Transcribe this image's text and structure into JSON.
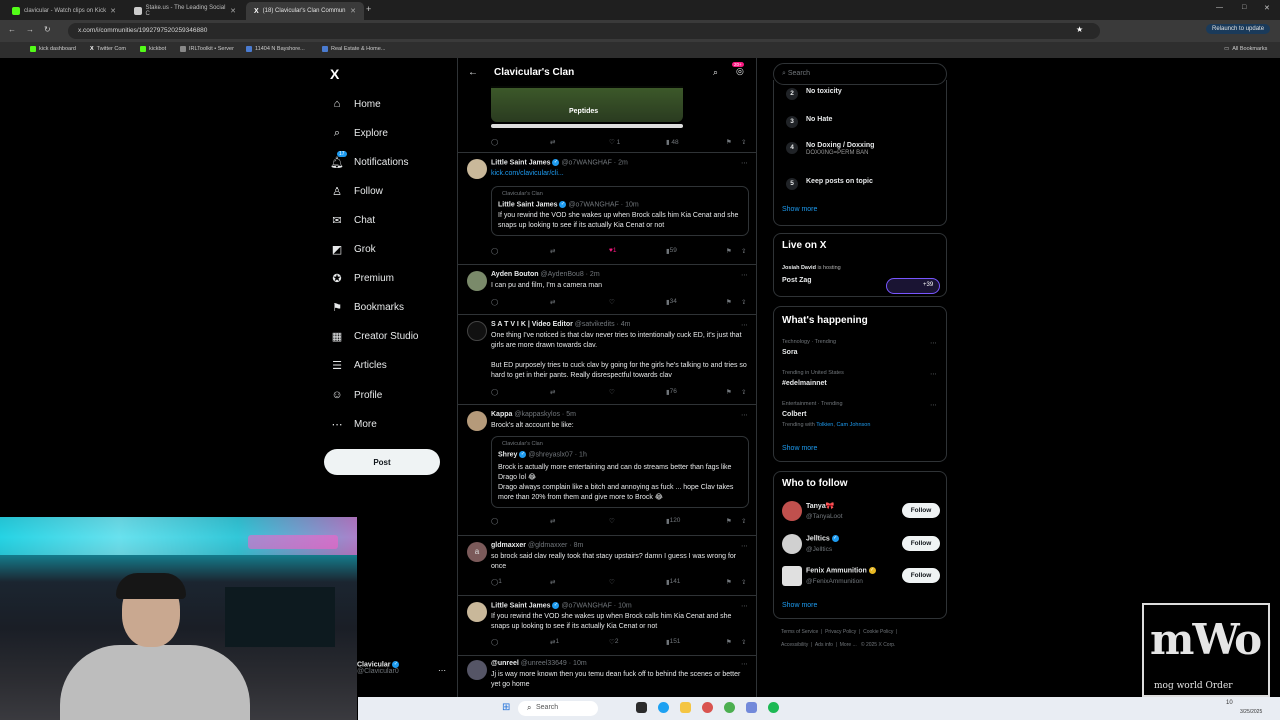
{
  "browser": {
    "tabs": [
      {
        "title": "clavicular - Watch clips on Kick",
        "color": "#53fc18"
      },
      {
        "title": "Stake.us - The Leading Social C",
        "color": "#cccccc"
      },
      {
        "title": "(18) Clavicular's Clan Commun",
        "color": "#ffffff"
      }
    ],
    "url": "x.com/i/communities/1992797520259346880",
    "relaunch": "Relaunch to update",
    "bookmarks": [
      "kick dashboard",
      "Twitter Com",
      "kickbot",
      "IRLToolkit • Server",
      "11404 N Bayshore...",
      "Real Estate & Home..."
    ],
    "all_bookmarks": "All Bookmarks"
  },
  "nav": {
    "logo": "X",
    "items": [
      {
        "label": "Home",
        "icon": "⌂"
      },
      {
        "label": "Explore",
        "icon": "⌕"
      },
      {
        "label": "Notifications",
        "icon": "🔔︎",
        "badge": "17"
      },
      {
        "label": "Follow",
        "icon": "♙"
      },
      {
        "label": "Chat",
        "icon": "✉"
      },
      {
        "label": "Grok",
        "icon": "◩"
      },
      {
        "label": "Premium",
        "icon": "✪"
      },
      {
        "label": "Bookmarks",
        "icon": "⚑"
      },
      {
        "label": "Creator Studio",
        "icon": "▦"
      },
      {
        "label": "Articles",
        "icon": "☰"
      },
      {
        "label": "Profile",
        "icon": "☺"
      },
      {
        "label": "More",
        "icon": "⋯"
      }
    ],
    "post": "Post"
  },
  "header": {
    "title": "Clavicular's Clan",
    "badge": "20+"
  },
  "top_media_label": "Peptides",
  "tweets": [
    {
      "name": "Little Saint James",
      "handle": "@o7WANGHAF · 2m",
      "text": "kick.com/clavicular/cli...",
      "quote": {
        "src": "Clavicular's Clan",
        "name": "Little Saint James",
        "handle": "@o7WANGHAF · 10m",
        "text": "If you rewind the VOD she wakes up when Brock calls him Kia Cenat and she snaps up looking to see if its actually Kia Cenat or not"
      },
      "likes": "1",
      "views": "59"
    },
    {
      "name": "Ayden Bouton",
      "handle": "@AydenBou8 · 2m",
      "text": "I can pu and film, I'm a camera man",
      "views": "34"
    },
    {
      "name": "S A T V I K | Video Editor",
      "handle": "@satvikedits · 4m",
      "text": "One thing I've noticed is that clav never tries to intentionally cuck ED, it's just that girls are more drawn towards clav.",
      "text2": "But ED purposely tries to cuck clav by going for the girls he's talking to and tries so hard to get in their pants. Really disrespectful towards clav",
      "views": "76"
    },
    {
      "name": "Kappa",
      "handle": "@kappaskylos · 5m",
      "text": "Brock's alt account be like:",
      "quote": {
        "src": "Clavicular's Clan",
        "name": "Shrey",
        "handle": "@shreyaslx07 · 1h",
        "text": "Brock is actually more entertaining and can do streams better than fags like Drago lol 😂",
        "text2": "Drago always complain like a bitch and annoying as fuck ... hope Clav takes more than 20% from them and give more to Brock 😂"
      },
      "views": "120"
    },
    {
      "name": "gldmaxxer",
      "handle": "@gldmaxxer · 8m",
      "text": "so brock said clav really took that stacy upstairs? damn I guess I was wrong for once",
      "replies": "1",
      "views": "141",
      "avatar": "a"
    },
    {
      "name": "Little Saint James",
      "handle": "@o7WANGHAF · 10m",
      "text": "If you rewind the VOD she wakes up when Brock calls him Kia Cenat and she snaps up looking to see if its actually Kia Cenat or not",
      "retweets": "1",
      "likes": "2",
      "views": "151"
    },
    {
      "name": "@unreel",
      "handle": "@unreel33649 · 10m",
      "text": "Jj is way more known then you temu dean fuck off to behind the scenes or better yet go home"
    }
  ],
  "right": {
    "search_placeholder": "Search",
    "rules": [
      {
        "n": "2",
        "t": "No toxicity"
      },
      {
        "n": "3",
        "t": "No Hate"
      },
      {
        "n": "4",
        "t": "No Doxing / Doxxing",
        "sub": "DOXXING=PERM BAN"
      },
      {
        "n": "5",
        "t": "Keep posts on topic"
      }
    ],
    "show_more": "Show more",
    "live": {
      "title": "Live on X",
      "host": "Josiah David",
      "hosting": "is hosting",
      "name": "Post Zag",
      "count": "+39"
    },
    "happening": {
      "title": "What's happening",
      "trends": [
        {
          "cat": "Technology · Trending",
          "name": "Sora"
        },
        {
          "cat": "Trending in United States",
          "name": "#edelmainnet"
        },
        {
          "cat": "Entertainment · Trending",
          "name": "Colbert",
          "with": "Trending with",
          "w1": "Tolkien",
          "w2": "Cam Johnson"
        }
      ]
    },
    "wtf": {
      "title": "Who to follow",
      "users": [
        {
          "name": "Tanya🎀",
          "handle": "@TanyaLoot",
          "color": "#c0504d"
        },
        {
          "name": "Jelltics",
          "handle": "@Jelltics",
          "color": "#d0d0d0"
        },
        {
          "name": "Fenix Ammunition",
          "handle": "@FenixAmmunition",
          "color": "#e0e0e0"
        }
      ],
      "follow": "Follow"
    },
    "footer": [
      "Terms of Service",
      "Privacy Policy",
      "Cookie Policy",
      "Accessibility",
      "Ads info",
      "More ...",
      "© 2025 X Corp."
    ]
  },
  "user_chip": {
    "name": "Clavicular",
    "handle": "@Clavicular0"
  },
  "overlay": {
    "logo": "mWo",
    "tagline": "mog world Order"
  },
  "taskbar": {
    "search": "Search",
    "time": "10",
    "date": "3/25/2025"
  }
}
